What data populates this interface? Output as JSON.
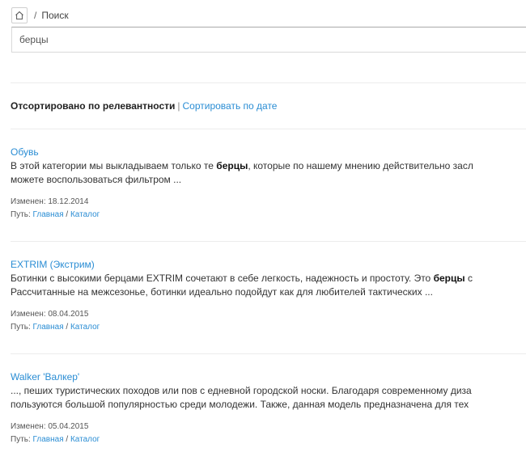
{
  "breadcrumb": {
    "separator": "/",
    "current": "Поиск"
  },
  "search": {
    "value": "берцы",
    "placeholder": ""
  },
  "sort": {
    "active": "Отсортировано по релевантности",
    "pipe": "|",
    "alt_link": "Сортировать по дате"
  },
  "labels": {
    "changed": "Изменен:",
    "path": "Путь:"
  },
  "results": [
    {
      "title": "Обувь",
      "line1_pre": "В этой категории мы выкладываем только те ",
      "line1_bold": "берцы",
      "line1_post": ", которые по нашему мнению действительно засл",
      "line2": "можете воспользоваться фильтром ...",
      "date": "18.12.2014",
      "path": [
        "Главная",
        "Каталог"
      ]
    },
    {
      "title": "EXTRIM (Экстрим)",
      "line1_pre": "Ботинки с высокими берцами EXTRIM сочетают в себе легкость, надежность и простоту. Это ",
      "line1_bold": "берцы",
      "line1_post": " с",
      "line2": "Рассчитанные на межсезонье, ботинки идеально подойдут как для любителей тактических ...",
      "date": "08.04.2015",
      "path": [
        "Главная",
        "Каталог"
      ]
    },
    {
      "title": "Walker 'Валкер'",
      "line1_pre": "..., пеших туристических походов или пов с едневной городской носки. Благодаря современному диза",
      "line1_bold": "",
      "line1_post": "",
      "line2": "пользуются большой популярностью среди молодежи. Также, данная модель предназначена для тех",
      "date": "05.04.2015",
      "path": [
        "Главная",
        "Каталог"
      ]
    }
  ]
}
